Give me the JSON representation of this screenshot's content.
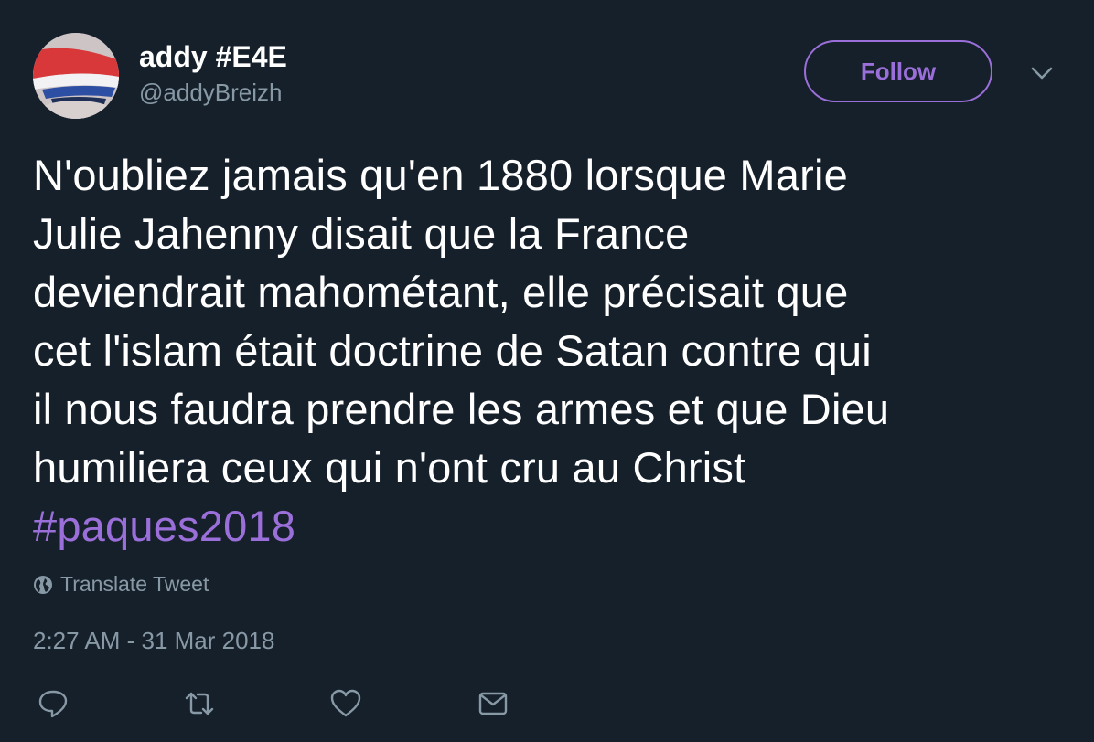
{
  "user": {
    "display_name": "addy #E4E",
    "handle": "@addyBreizh"
  },
  "header": {
    "follow_label": "Follow",
    "menu_icon": "chevron-down-icon"
  },
  "tweet": {
    "lines": [
      "N'oubliez jamais qu'en 1880 lorsque Marie",
      "Julie Jahenny disait que la France",
      "deviendrait mahométant, elle précisait que",
      "cet l'islam était doctrine de Satan contre qui",
      "il nous faudra prendre les armes et que Dieu",
      "humiliera ceux qui n'ont cru au Christ"
    ],
    "hashtag": "#paques2018",
    "translate_label": "Translate Tweet",
    "timestamp": "2:27 AM - 31 Mar 2018"
  },
  "actions": {
    "icons": [
      "reply-icon",
      "retweet-icon",
      "like-icon",
      "message-icon"
    ]
  },
  "colors": {
    "background": "#15202b",
    "text": "#ffffff",
    "secondary": "#8899a6",
    "accent": "#9b6fd9"
  }
}
